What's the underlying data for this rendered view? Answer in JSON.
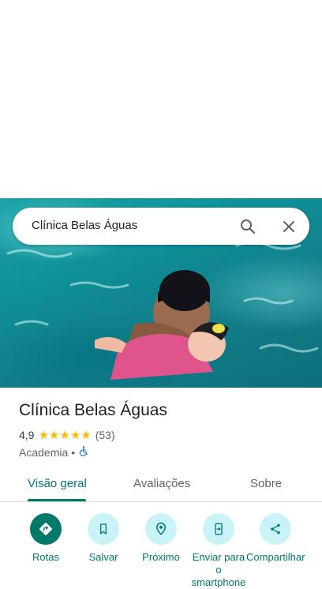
{
  "search": {
    "query": "Clínica Belas Águas"
  },
  "place": {
    "name": "Clínica Belas Águas",
    "rating": "4,9",
    "stars": 5,
    "review_count": "(53)",
    "category": "Academia",
    "separator": "•"
  },
  "tabs": [
    {
      "label": "Visão geral",
      "active": true
    },
    {
      "label": "Avaliações",
      "active": false
    },
    {
      "label": "Sobre",
      "active": false
    }
  ],
  "actions": [
    {
      "label": "Rotas",
      "icon": "directions-icon"
    },
    {
      "label": "Salvar",
      "icon": "bookmark-icon"
    },
    {
      "label": "Próximo",
      "icon": "nearby-icon"
    },
    {
      "label": "Enviar para o smartphone",
      "icon": "send-to-phone-icon"
    },
    {
      "label": "Compartilhar",
      "icon": "share-icon"
    }
  ],
  "colors": {
    "accent": "#00796b",
    "action_bg": "#c9f3f7",
    "star": "#fbbc04",
    "accessible_icon": "#1a73e8"
  }
}
